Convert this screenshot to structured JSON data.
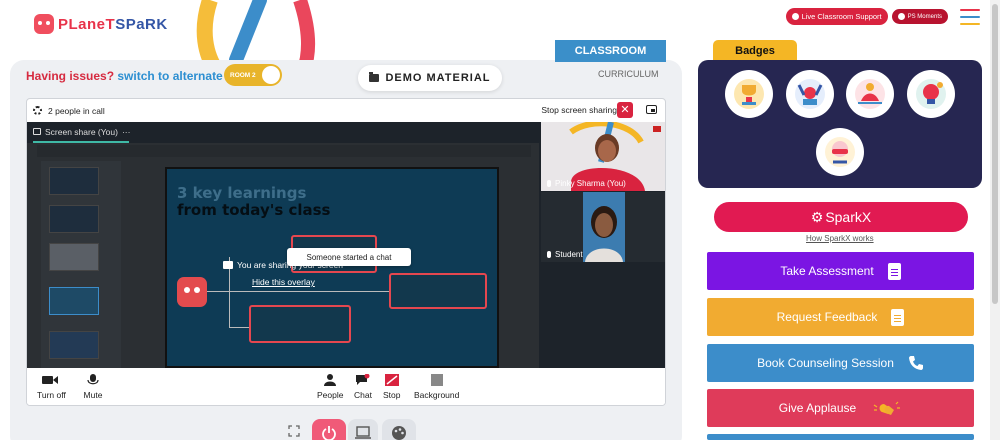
{
  "brand": {
    "logo_part1": "PLaneT",
    "logo_part2": "SPaRK"
  },
  "header": {
    "support_label": "Live Classroom Support",
    "moments_label": "PS Moments"
  },
  "classroom": {
    "issues_question": "Having issues?",
    "switch_link": "switch to alternate room",
    "room_label": "ROOM 2",
    "demo_material": "DEMO MATERIAL",
    "tab_classroom": "CLASSROOM",
    "tab_curriculum": "CURRICULUM"
  },
  "call": {
    "people_in_call": "2 people in call",
    "stop_sharing": "Stop screen sharing",
    "share_tab": "Screen share (You)",
    "share_tab_more": "···",
    "slide_title_1": "3 key learnings",
    "slide_title_2": "from today's class",
    "overlay_text": "You are sharing your screen",
    "overlay_hide": "Hide this overlay",
    "participants": [
      {
        "name": "Pinky Sharma (You)"
      },
      {
        "name": "Student"
      }
    ],
    "toast": "Someone started a chat",
    "controls": {
      "turn_off": "Turn off",
      "mute": "Mute",
      "people": "People",
      "chat": "Chat",
      "stop": "Stop",
      "background": "Background"
    }
  },
  "badges": {
    "title": "Badges"
  },
  "sparkx": {
    "label": "SparkX",
    "how_link": "How SparkX works"
  },
  "actions": {
    "take_assessment": "Take Assessment",
    "request_feedback": "Request Feedback",
    "book_counseling": "Book Counseling Session",
    "give_applause": "Give Applause"
  },
  "colors": {
    "brand_red": "#e8334a",
    "brand_blue": "#3456a6",
    "assessment": "#7b15e3",
    "feedback": "#f1ab31",
    "counseling": "#3c8dca",
    "applause": "#df3b5a",
    "badges_panel": "#262651",
    "sparkx": "#e11a52"
  }
}
